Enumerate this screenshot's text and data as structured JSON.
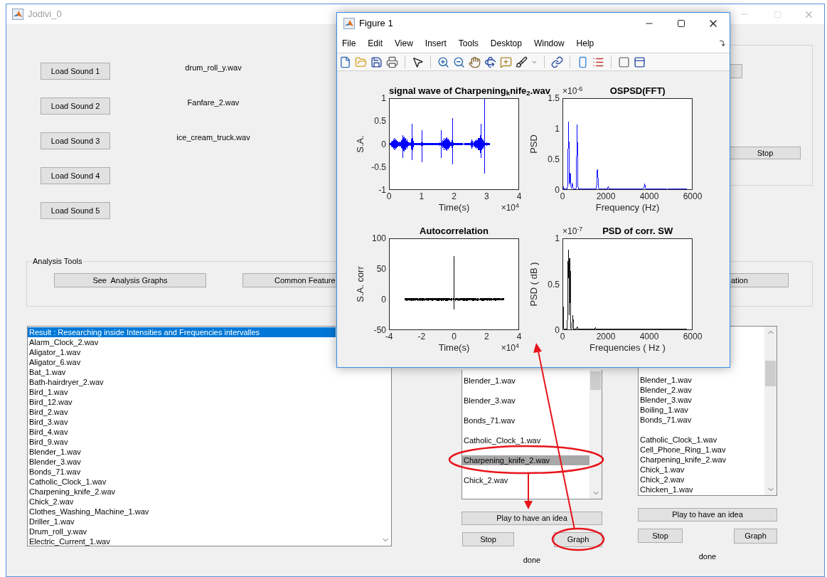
{
  "main_window": {
    "title": "Jodivi_0"
  },
  "load_sounds": [
    {
      "button": "Load Sound 1",
      "file": "drum_roll_y.wav"
    },
    {
      "button": "Load Sound 2",
      "file": "Fanfare_2.wav"
    },
    {
      "button": "Load Sound 3",
      "file": "ice_cream_truck.wav"
    },
    {
      "button": "Load Sound 4"
    },
    {
      "button": "Load Sound 5"
    }
  ],
  "playback_panel": {
    "stop_button": "Stop"
  },
  "analysis_tools": {
    "title": "Analysis Tools",
    "buttons": [
      "See  Analysis Graphs",
      "Common Feature",
      "ation"
    ]
  },
  "result_list": {
    "focused": true,
    "items": [
      {
        "label": "Result : Researching inside Intensities and Frequencies intervalles",
        "selected": true
      },
      {
        "label": "Alarm_Clock_2.wav",
        "selected": false
      },
      {
        "label": "Aligator_1.wav",
        "selected": false
      },
      {
        "label": "Aligator_6.wav",
        "selected": false
      },
      {
        "label": "Bat_1.wav",
        "selected": false
      },
      {
        "label": "Bath-hairdryer_2.wav",
        "selected": false
      },
      {
        "label": "Bird_1.wav",
        "selected": false
      },
      {
        "label": "Bird_12.wav",
        "selected": false
      },
      {
        "label": "Bird_2.wav",
        "selected": false
      },
      {
        "label": "Bird_3.wav",
        "selected": false
      },
      {
        "label": "Bird_4.wav",
        "selected": false
      },
      {
        "label": "Bird_9.wav",
        "selected": false
      },
      {
        "label": "Blender_1.wav",
        "selected": false
      },
      {
        "label": "Blender_3.wav",
        "selected": false
      },
      {
        "label": "Bonds_71.wav",
        "selected": false
      },
      {
        "label": "Catholic_Clock_1.wav",
        "selected": false
      },
      {
        "label": "Charpening_knife_2.wav",
        "selected": false
      },
      {
        "label": "Chick_2.wav",
        "selected": false
      },
      {
        "label": "Clothes_Washing_Machine_1.wav",
        "selected": false
      },
      {
        "label": "Driller_1.wav",
        "selected": false
      },
      {
        "label": "Drum_roll_y.wav",
        "selected": false
      },
      {
        "label": "Electric_Current_1.wav",
        "selected": false
      }
    ]
  },
  "sound_columns": [
    {
      "list": {
        "items": [
          {
            "label": "Blender_1.wav",
            "selected": false
          },
          {
            "label": "Blender_3.wav",
            "selected": false
          },
          {
            "label": "Bonds_71.wav",
            "selected": false
          },
          {
            "label": "Catholic_Clock_1.wav",
            "selected": false
          },
          {
            "label": "Charpening_knife_2.wav",
            "selected": true
          },
          {
            "label": "Chick_2.wav",
            "selected": false
          }
        ]
      },
      "play_button": "Play to have an idea",
      "stop_button": "Stop",
      "graph_button": "Graph",
      "status": "done"
    },
    {
      "list": {
        "items": [
          {
            "label": "Blender_1.wav",
            "selected": false
          },
          {
            "label": "Blender_2.wav",
            "selected": false
          },
          {
            "label": "Blender_3.wav",
            "selected": false
          },
          {
            "label": "Boiling_1.wav",
            "selected": false
          },
          {
            "label": "Bonds_71.wav",
            "selected": false
          },
          {
            "label": "Catholic_Clock_1.wav",
            "selected": false
          },
          {
            "label": "Cell_Phone_Ring_1.wav",
            "selected": false
          },
          {
            "label": "Charpening_knife_2.wav",
            "selected": false
          },
          {
            "label": "Chick_1.wav",
            "selected": false
          },
          {
            "label": "Chick_2.wav",
            "selected": false
          },
          {
            "label": "Chicken_1.wav",
            "selected": false
          }
        ]
      },
      "play_button": "Play to have an idea",
      "stop_button": "Stop",
      "graph_button": "Graph",
      "status": "done"
    }
  ],
  "figure": {
    "title": "Figure 1",
    "menu": [
      "File",
      "Edit",
      "View",
      "Insert",
      "Tools",
      "Desktop",
      "Window",
      "Help"
    ],
    "plots": [
      {
        "kind": "signal",
        "color": "#0000ff",
        "title": "signal wave of Charpening$_{k}$nife$_{2}$.wav",
        "ylabel": "S.A.",
        "xlabel": "Time(s)",
        "x_exponent": "×10$^{4}$",
        "xticks": [
          "0",
          "1",
          "2",
          "3",
          "4"
        ],
        "yticks": [
          "1",
          "0.5",
          "0",
          "-0.5",
          "-1"
        ]
      },
      {
        "kind": "spectrum",
        "color": "#0000ff",
        "title": "OSPSD(FFT)",
        "ylabel": "PSD",
        "xlabel": "Frequency (Hz)",
        "y_exponent": "×10$^{-6}$",
        "xticks": [
          "0",
          "2000",
          "4000",
          "6000"
        ],
        "yticks": [
          "1.5",
          "1",
          "0.5",
          "0"
        ]
      },
      {
        "kind": "autocorrelation",
        "color": "#000000",
        "title": "Autocorrelation",
        "ylabel": "S.A. corr",
        "xlabel": "Time(s)",
        "x_exponent": "×10$^{4}$",
        "xticks": [
          "-4",
          "-2",
          "0",
          "2",
          "4"
        ],
        "yticks": [
          "100",
          "50",
          "0",
          "-50"
        ]
      },
      {
        "kind": "correlation_spectrum",
        "color": "#000000",
        "title": "PSD of corr. SW",
        "ylabel": "PSD ( dB )",
        "xlabel": "Frequencies ( Hz )",
        "y_exponent": "×10$^{-7}$",
        "xticks": [
          "0",
          "2000",
          "4000",
          "6000"
        ],
        "yticks": [
          "1",
          "0.5",
          "0"
        ]
      }
    ]
  }
}
